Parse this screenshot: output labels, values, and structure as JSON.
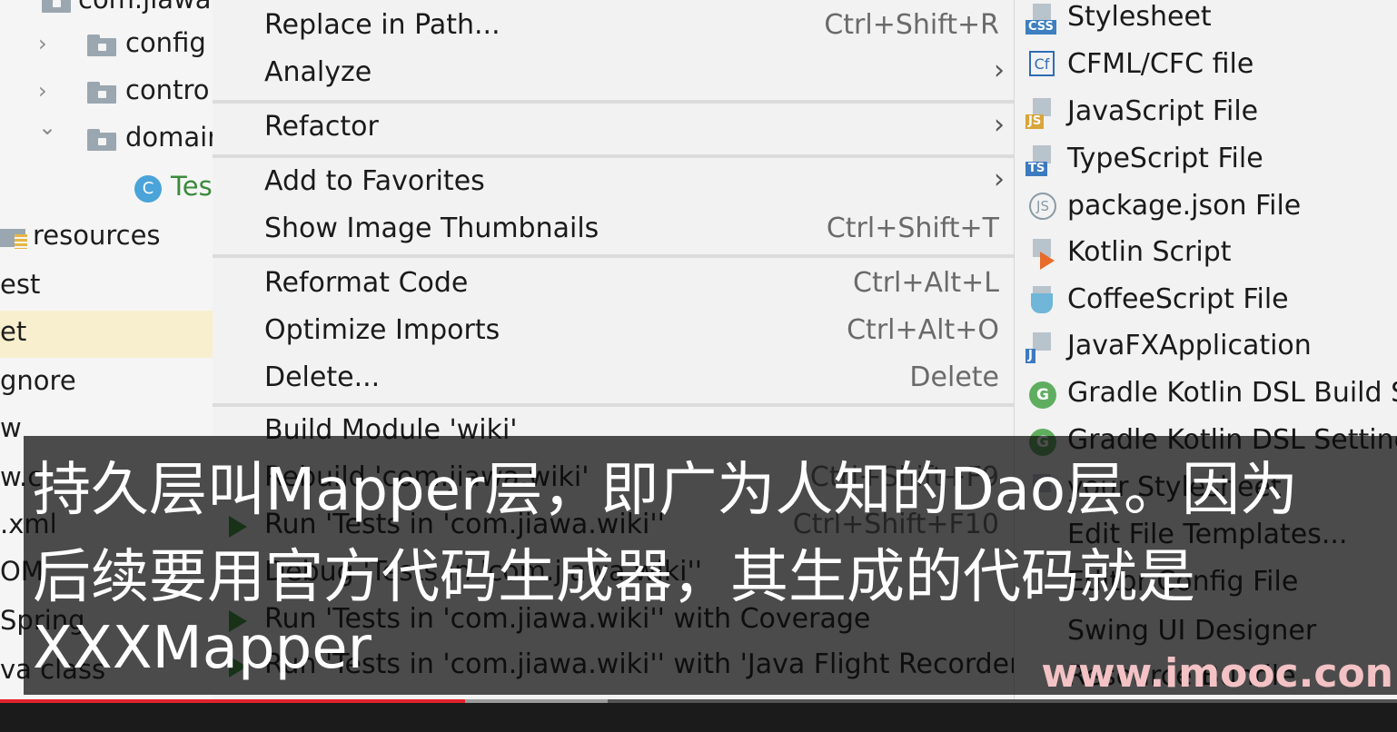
{
  "tree": {
    "rows": [
      {
        "label": "com.jiawa.",
        "type": "package"
      },
      {
        "label": "config",
        "type": "folder"
      },
      {
        "label": "contro",
        "type": "folder"
      },
      {
        "label": "domair",
        "type": "folder-open"
      },
      {
        "label": "Tes",
        "type": "class",
        "icon_letter": "C"
      },
      {
        "label": "resources",
        "type": "resources"
      },
      {
        "label": "est",
        "type": "text"
      },
      {
        "label": "et",
        "type": "text-selected"
      },
      {
        "label": "gnore",
        "type": "text"
      },
      {
        "label": "w",
        "type": "text"
      },
      {
        "label": "w.c",
        "type": "text"
      },
      {
        "label": ".xml",
        "type": "text"
      },
      {
        "label": "OM",
        "type": "text"
      },
      {
        "label": "Spring",
        "type": "text"
      },
      {
        "label": "va class",
        "type": "text"
      }
    ]
  },
  "menu": {
    "items": [
      {
        "label": "Replace in Path...",
        "shortcut": "Ctrl+Shift+R"
      },
      {
        "label": "Analyze",
        "submenu": true
      },
      {
        "label": "Refactor",
        "submenu": true
      },
      {
        "label": "Add to Favorites",
        "submenu": true
      },
      {
        "label": "Show Image Thumbnails",
        "shortcut": "Ctrl+Shift+T"
      },
      {
        "label": "Reformat Code",
        "shortcut": "Ctrl+Alt+L"
      },
      {
        "label": "Optimize Imports",
        "shortcut": "Ctrl+Alt+O"
      },
      {
        "label": "Delete...",
        "shortcut": "Delete"
      },
      {
        "label": "Build Module 'wiki'"
      },
      {
        "label": "Rebuild 'com.jiawa.wiki'",
        "shortcut": "Ctrl+Shift+F9"
      },
      {
        "label": "Run 'Tests in 'com.jiawa.wiki''",
        "shortcut": "Ctrl+Shift+F10"
      },
      {
        "label": "Debug 'Tests in 'com.jiawa.wiki''"
      },
      {
        "label": "Run 'Tests in 'com.jiawa.wiki'' with Coverage"
      },
      {
        "label": "Run 'Tests in 'com.jiawa.wiki'' with 'Java Flight Recorder'"
      }
    ]
  },
  "submenu": {
    "items": [
      {
        "label": "Stylesheet",
        "icon": "css-file-icon",
        "badge": "CSS",
        "badge_color": "#3d7fc1"
      },
      {
        "label": "CFML/CFC file",
        "icon": "cfml-file-icon",
        "badge": "Cf"
      },
      {
        "label": "JavaScript File",
        "icon": "javascript-file-icon",
        "badge": "JS",
        "badge_color": "#d9a43a"
      },
      {
        "label": "TypeScript File",
        "icon": "typescript-file-icon",
        "badge": "TS",
        "badge_color": "#3c7ac0"
      },
      {
        "label": "package.json File",
        "icon": "package-json-icon",
        "badge": "JS"
      },
      {
        "label": "Kotlin Script",
        "icon": "kotlin-script-icon"
      },
      {
        "label": "CoffeeScript File",
        "icon": "coffeescript-file-icon"
      },
      {
        "label": "JavaFXApplication",
        "icon": "javafx-file-icon",
        "badge": "J",
        "badge_color": "#3c7ac0"
      },
      {
        "label": "Gradle Kotlin DSL Build Sc",
        "icon": "gradle-icon",
        "badge": "G"
      },
      {
        "label": "Gradle Kotlin DSL Setting",
        "icon": "gradle-icon",
        "badge": "G"
      },
      {
        "label": "your Stylesheet",
        "icon": "css-file-icon"
      },
      {
        "label": "Edit File Templates...",
        "icon": ""
      },
      {
        "label": "Editor Config File",
        "icon": ""
      },
      {
        "label": "Swing UI Designer",
        "icon": ""
      },
      {
        "label": "Resource Bundle",
        "icon": ""
      }
    ]
  },
  "subtitle": {
    "line1": "持久层叫Mapper层，即广为人知的Dao层。因为",
    "line2": "后续要用官方代码生成器，其生成的代码就是",
    "line3": "XXXMapper"
  },
  "watermark": "www.imooc.con",
  "player": {
    "played_fraction": 0.333,
    "buffered_fraction": 0.435
  }
}
